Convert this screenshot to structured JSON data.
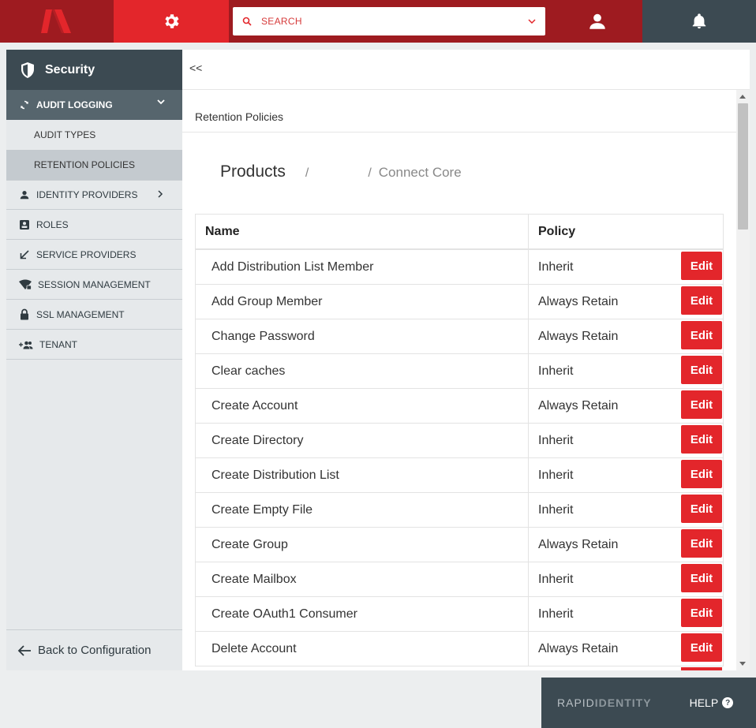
{
  "topbar": {
    "search_placeholder": "SEARCH",
    "brand_color": "#e3262b",
    "dark_color": "#9e1b20"
  },
  "sidebar": {
    "title": "Security",
    "audit_logging": "AUDIT LOGGING",
    "sub_items": [
      {
        "label": "AUDIT TYPES",
        "active": false
      },
      {
        "label": "RETENTION POLICIES",
        "active": true
      }
    ],
    "items": [
      {
        "label": "IDENTITY PROVIDERS",
        "icon": "person-icon"
      },
      {
        "label": "ROLES",
        "icon": "badge-icon"
      },
      {
        "label": "SERVICE PROVIDERS",
        "icon": "arrow-icon"
      },
      {
        "label": "SESSION MANAGEMENT",
        "icon": "wifi-lock-icon"
      },
      {
        "label": "SSL MANAGEMENT",
        "icon": "lock-icon"
      },
      {
        "label": "TENANT",
        "icon": "group-add-icon"
      }
    ],
    "back_label": "Back to Configuration"
  },
  "main": {
    "collapse_label": "<<",
    "section_title": "Retention Policies",
    "breadcrumb": {
      "first": "Products",
      "sep": "/",
      "third": "Connect Core"
    },
    "table": {
      "headers": {
        "name": "Name",
        "policy": "Policy"
      },
      "edit_label": "Edit",
      "rows": [
        {
          "name": "Add Distribution List Member",
          "policy": "Inherit"
        },
        {
          "name": "Add Group Member",
          "policy": "Always Retain"
        },
        {
          "name": "Change Password",
          "policy": "Always Retain"
        },
        {
          "name": "Clear caches",
          "policy": "Inherit"
        },
        {
          "name": "Create Account",
          "policy": "Always Retain"
        },
        {
          "name": "Create Directory",
          "policy": "Inherit"
        },
        {
          "name": "Create Distribution List",
          "policy": "Inherit"
        },
        {
          "name": "Create Empty File",
          "policy": "Inherit"
        },
        {
          "name": "Create Group",
          "policy": "Always Retain"
        },
        {
          "name": "Create Mailbox",
          "policy": "Inherit"
        },
        {
          "name": "Create OAuth1 Consumer",
          "policy": "Inherit"
        },
        {
          "name": "Delete Account",
          "policy": "Always Retain"
        }
      ]
    }
  },
  "footer": {
    "brand_light": "RAPID",
    "brand_bold": "IDENTITY",
    "help_label": "HELP",
    "help_icon_char": "?"
  }
}
